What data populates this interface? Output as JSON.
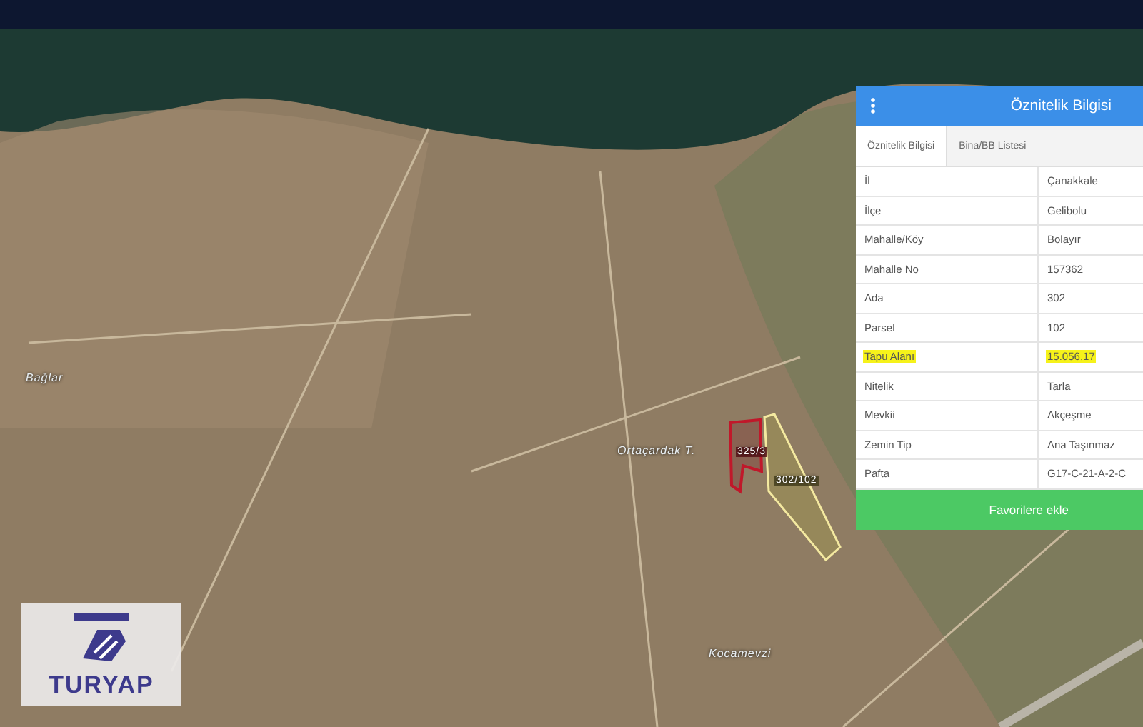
{
  "map": {
    "place_labels": [
      {
        "text": "Bağlar"
      },
      {
        "text": "Ortaçardak T."
      },
      {
        "text": "Kocamevzi"
      }
    ],
    "parcels": [
      {
        "label": "325/3",
        "kind": "outlined"
      },
      {
        "label": "302/102",
        "kind": "filled"
      }
    ]
  },
  "logo": {
    "text": "TURYAP"
  },
  "panel": {
    "title": "Öznitelik Bilgisi",
    "tabs": [
      {
        "label": "Öznitelik Bilgisi",
        "selected": true
      },
      {
        "label": "Bina/BB Listesi",
        "selected": false
      }
    ],
    "rows": [
      {
        "label": "İl",
        "value": "Çanakkale",
        "highlighted": false
      },
      {
        "label": "İlçe",
        "value": "Gelibolu",
        "highlighted": false
      },
      {
        "label": "Mahalle/Köy",
        "value": "Bolayır",
        "highlighted": false
      },
      {
        "label": "Mahalle No",
        "value": "157362",
        "highlighted": false
      },
      {
        "label": "Ada",
        "value": "302",
        "highlighted": false
      },
      {
        "label": "Parsel",
        "value": "102",
        "highlighted": false
      },
      {
        "label": "Tapu Alanı",
        "value": "15.056,17",
        "highlighted": true
      },
      {
        "label": "Nitelik",
        "value": "Tarla",
        "highlighted": false
      },
      {
        "label": "Mevkii",
        "value": "Akçeşme",
        "highlighted": false
      },
      {
        "label": "Zemin Tip",
        "value": "Ana Taşınmaz",
        "highlighted": false
      },
      {
        "label": "Pafta",
        "value": "G17-C-21-A-2-C",
        "highlighted": false
      }
    ],
    "button": "Favorilere ekle"
  }
}
